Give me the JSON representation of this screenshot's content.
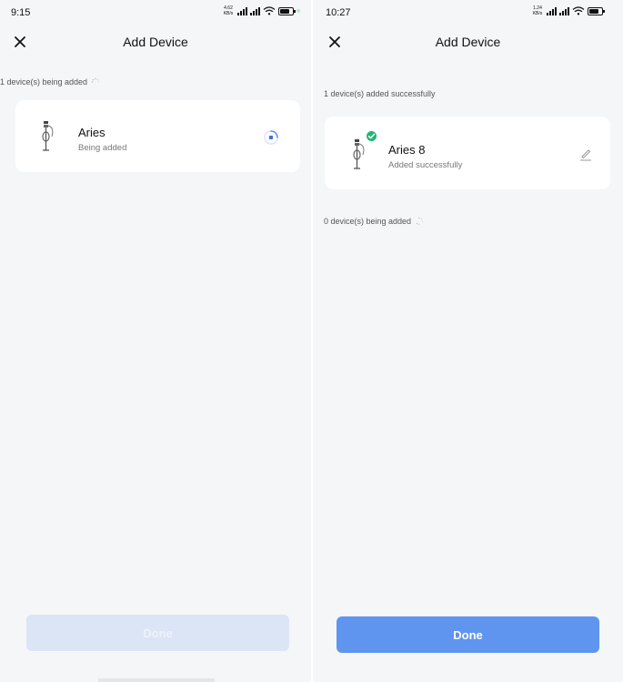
{
  "left": {
    "status": {
      "time": "9:15",
      "net_speed": "4.62 KB/s"
    },
    "header": {
      "title": "Add Device"
    },
    "adding_section": {
      "label": "1 device(s) being added"
    },
    "device": {
      "name": "Aries",
      "status": "Being added"
    },
    "done_button": {
      "label": "Done",
      "enabled": false
    }
  },
  "right": {
    "status": {
      "time": "10:27",
      "net_speed": "1.24 KB/s"
    },
    "header": {
      "title": "Add Device"
    },
    "success_section": {
      "label": "1 device(s) added successfully"
    },
    "device": {
      "name": "Aries 8",
      "status": "Added successfully"
    },
    "adding_section": {
      "label": "0 device(s) being added"
    },
    "done_button": {
      "label": "Done",
      "enabled": true
    }
  },
  "icons": {
    "close": "close-icon",
    "spinner": "spinner-icon",
    "loading": "loading-icon",
    "device": "ev-charger-icon",
    "check": "check-icon",
    "edit": "pencil-icon",
    "wifi": "wifi-icon",
    "battery": "battery-icon",
    "signal": "signal-icon"
  },
  "colors": {
    "accent": "#5f95ee",
    "accent_disabled": "#dbe5f6",
    "success": "#22b573",
    "background": "#f5f6f8",
    "card": "#ffffff"
  }
}
